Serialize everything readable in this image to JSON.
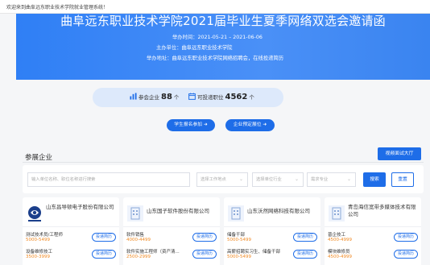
{
  "topbar": {
    "welcome": "欢迎来到曲阜远东职业技术学院就业管理系统！"
  },
  "banner": {
    "title": "曲阜远东职业技术学院2021届毕业生夏季网络双选会邀请函",
    "time_label": "举办时间：",
    "time_value": "2021-05-21 – 2021-06-06",
    "host_label": "主办单位：",
    "host_value": "曲阜远东职业技术学院",
    "addr_label": "举办地址：",
    "addr_value": "曲阜远东职业技术学院网络招聘会，在线投递简历"
  },
  "stats": {
    "companies_label": "参会企业",
    "companies_count": "88",
    "companies_unit": "个",
    "resumes_label": "可投递职位",
    "resumes_count": "4562",
    "resumes_unit": "个"
  },
  "actions": {
    "student_signup": "学生报名参加 ➜",
    "company_booth": "企业预定展位 ➜"
  },
  "section": {
    "title": "参展企业",
    "video_button": "视频面试大厅"
  },
  "filters": {
    "keyword_placeholder": "输入单位名称、职位名称进行搜索",
    "location_placeholder": "选择工作地点",
    "industry_placeholder": "选择单位行业",
    "major_placeholder": "需求专业",
    "search_button": "搜索",
    "reset_button": "重置"
  },
  "colors": {
    "primary": "#1e6de8",
    "salary": "#f08a24",
    "banner": "#3a84f0"
  },
  "companies": [
    {
      "name": "山东昌导顿电子股份有限公司",
      "logo": "company-logo",
      "jobs": [
        {
          "title": "测试技术员/工程师",
          "salary": "5000-5499",
          "apply": "投递简历"
        },
        {
          "title": "设备维修技工",
          "salary": "3500-3999",
          "apply": "投递简历"
        }
      ]
    },
    {
      "name": "山东国子软件股份有限公司",
      "logo": "building-icon",
      "jobs": [
        {
          "title": "软件销售",
          "salary": "4000-4499",
          "apply": "投递简历"
        },
        {
          "title": "软件实施工程师（资产清...",
          "salary": "2500-2999",
          "apply": "投递简历"
        }
      ]
    },
    {
      "name": "山东沃然网络科技有限公司",
      "logo": "building-icon",
      "jobs": [
        {
          "title": "储备干部",
          "salary": "5000-5499",
          "apply": "投递简历"
        },
        {
          "title": "高薪招聘实习生、储备干部",
          "salary": "5000-5499",
          "apply": "投递简历"
        }
      ]
    },
    {
      "name": "青岛海信宽带多媒体技术有限公司",
      "logo": "building-icon",
      "jobs": [
        {
          "title": "普企技工",
          "salary": "4500-4999",
          "apply": "投递简历"
        },
        {
          "title": "模块维修员",
          "salary": "4500-4999",
          "apply": "投递简历"
        }
      ]
    }
  ]
}
